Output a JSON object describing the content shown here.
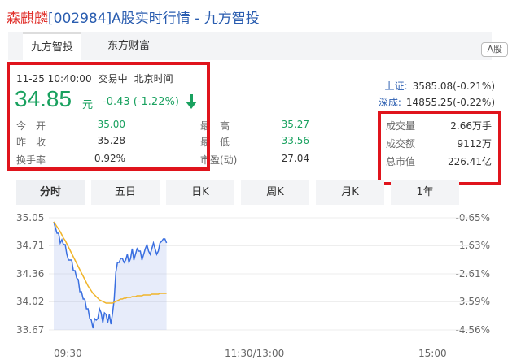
{
  "header": {
    "name": "森麒麟",
    "rest": "[002984]A股实时行情 - 九方智投"
  },
  "tabs": [
    "九方智投",
    "东方财富"
  ],
  "badge": "A股",
  "quote": {
    "time": "11-25 10:40:00",
    "status": "交易中",
    "tz": "北京时间",
    "price": "34.85",
    "unit": "元",
    "change": "-0.43 (-1.22%)"
  },
  "stats": {
    "open_label": "今　开",
    "open": "35.00",
    "high_label": "最　高",
    "high": "35.27",
    "prev_label": "昨　收",
    "prev": "35.28",
    "low_label": "最　低",
    "low": "33.56",
    "turnover_label": "换手率",
    "turnover": "0.92%",
    "pe_label": "市盈(动)",
    "pe": "27.04",
    "vol_label": "成交量",
    "vol": "2.66万手",
    "amt_label": "成交额",
    "amt": "9112万",
    "cap_label": "总市值",
    "cap": "226.41亿"
  },
  "indices": [
    {
      "label": "上证:",
      "value": "3585.08(-0.21%)"
    },
    {
      "label": "深成:",
      "value": "14855.25(-0.22%)"
    }
  ],
  "periods": [
    "分时",
    "五日",
    "日K",
    "周K",
    "月K",
    "1年"
  ],
  "colors": {
    "green": "#19a15f",
    "blue": "#2a5db0",
    "red": "#e0141c",
    "avg": "#f0b429"
  },
  "chart_data": {
    "type": "line",
    "y_left": [
      "35.05",
      "34.71",
      "34.36",
      "34.02",
      "33.67"
    ],
    "y_right": [
      "-0.65%",
      "-1.63%",
      "-2.61%",
      "-3.59%",
      "-4.56%"
    ],
    "x_labels": [
      "09:30",
      "11:30/13:00",
      "15:00"
    ],
    "ylim": [
      33.67,
      35.05
    ],
    "total_minutes": 240,
    "series": [
      {
        "values": [
          35.0,
          34.93,
          34.86,
          34.86,
          34.74,
          34.78,
          34.72,
          34.72,
          34.6,
          34.53,
          34.53,
          34.53,
          34.4,
          34.4,
          34.31,
          34.29,
          34.14,
          34.14,
          34.05,
          34.05,
          33.93,
          33.93,
          33.81,
          33.79,
          33.69,
          33.81,
          33.79,
          33.81,
          33.93,
          33.88,
          33.76,
          33.88,
          33.86,
          33.76,
          33.86,
          33.74,
          33.88,
          34.05,
          34.38,
          34.5,
          34.5,
          34.55,
          34.55,
          34.5,
          34.53,
          34.6,
          34.5,
          34.55,
          34.67,
          34.53,
          34.6,
          34.67,
          34.64,
          34.64,
          34.53,
          34.6,
          34.67,
          34.72,
          34.64,
          34.6,
          34.67,
          34.74,
          34.67,
          34.6,
          34.64,
          34.74,
          34.76,
          34.79,
          34.79,
          34.74
        ]
      },
      {
        "values": [
          35.0,
          34.97,
          34.94,
          34.91,
          34.88,
          34.84,
          34.8,
          34.77,
          34.73,
          34.69,
          34.65,
          34.61,
          34.57,
          34.53,
          34.49,
          34.45,
          34.41,
          34.37,
          34.33,
          34.29,
          34.25,
          34.21,
          34.18,
          34.15,
          34.12,
          34.1,
          34.08,
          34.06,
          34.04,
          34.03,
          34.02,
          34.01,
          34.0,
          34.0,
          34.0,
          34.0,
          34.0,
          34.01,
          34.02,
          34.03,
          34.04,
          34.05,
          34.05,
          34.06,
          34.06,
          34.07,
          34.07,
          34.07,
          34.08,
          34.08,
          34.08,
          34.09,
          34.09,
          34.09,
          34.09,
          34.1,
          34.1,
          34.1,
          34.1,
          34.1,
          34.11,
          34.11,
          34.11,
          34.11,
          34.11,
          34.12,
          34.12,
          34.12,
          34.12,
          34.12
        ]
      }
    ]
  }
}
